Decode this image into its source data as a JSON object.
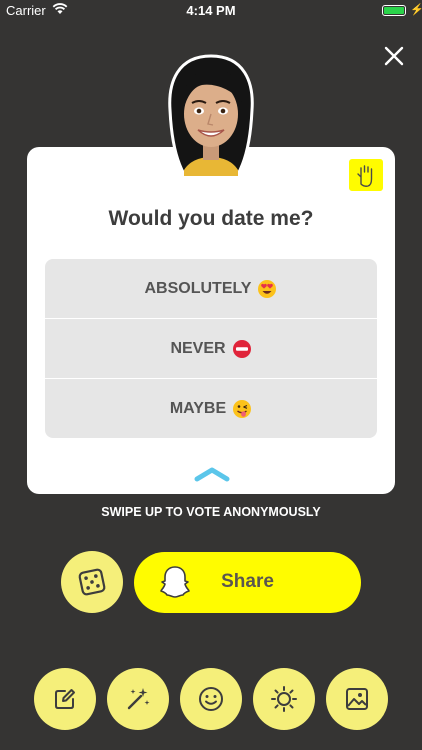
{
  "status_bar": {
    "carrier": "Carrier",
    "time": "4:14 PM"
  },
  "card": {
    "question": "Would you date me?",
    "options": [
      {
        "label": "ABSOLUTELY",
        "emoji": "heart-eyes-emoji"
      },
      {
        "label": "NEVER",
        "emoji": "no-entry-emoji"
      },
      {
        "label": "MAYBE",
        "emoji": "winking-tongue-emoji"
      }
    ]
  },
  "swipe_hint": "SWIPE UP TO VOTE ANONYMOUSLY",
  "share": {
    "label": "Share"
  },
  "colors": {
    "background": "#353433",
    "accent": "#fffc00",
    "accent_soft": "#f5ef7a"
  },
  "icons": [
    "close-icon",
    "raised-hand-icon",
    "chevron-up-icon",
    "dice-icon",
    "ghost-icon",
    "edit-icon",
    "magic-wand-icon",
    "smiley-icon",
    "brightness-icon",
    "image-icon"
  ]
}
